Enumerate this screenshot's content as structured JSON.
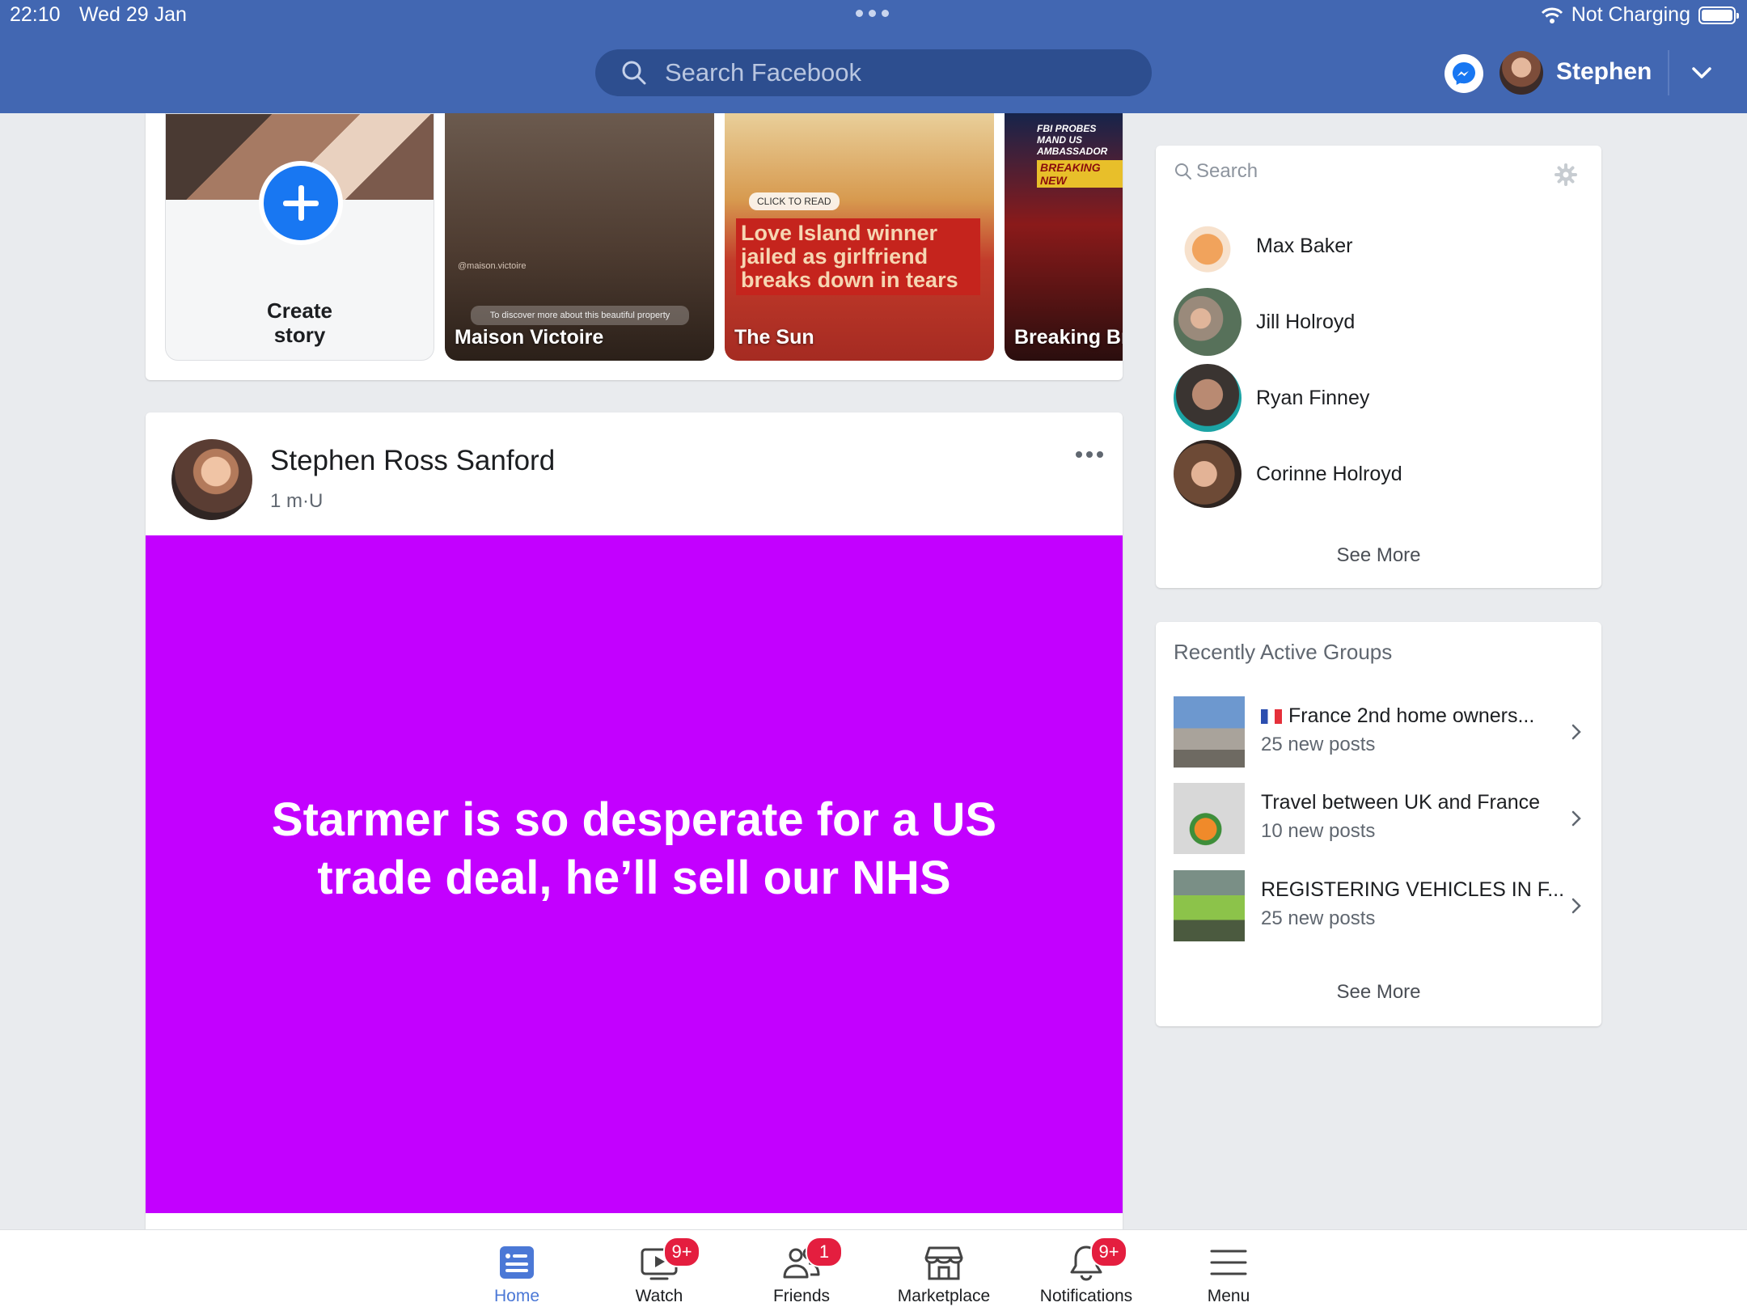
{
  "status_bar": {
    "time": "22:10",
    "date": "Wed 29 Jan",
    "charging": "Not Charging"
  },
  "header": {
    "search_placeholder": "Search Facebook",
    "user_name": "Stephen"
  },
  "stories": {
    "create_line1": "Create",
    "create_line2": "story",
    "items": [
      {
        "name": "Maison Victoire",
        "sub": "@maison.victoire",
        "pill": "To discover more about this beautiful property"
      },
      {
        "name": "The Sun",
        "pill": "CLICK TO READ",
        "headline": "Love Island winner jailed as girlfriend breaks down in tears"
      },
      {
        "name": "Breaking Br",
        "top": "FBI PROBES MAND US AMBASSADOR",
        "tag": "BREAKING NEW"
      }
    ]
  },
  "post": {
    "author": "Stephen Ross Sanford",
    "meta": "1 m·U",
    "text": "Starmer is so desperate for a US trade deal, he’ll sell our NHS",
    "background_color": "#c300ff"
  },
  "contacts": {
    "search_placeholder": "Search",
    "items": [
      {
        "name": "Max Baker"
      },
      {
        "name": "Jill Holroyd"
      },
      {
        "name": "Ryan Finney"
      },
      {
        "name": "Corinne Holroyd"
      }
    ],
    "see_more": "See More"
  },
  "groups": {
    "title": "Recently Active Groups",
    "items": [
      {
        "name": "France 2nd home owners...",
        "posts": "25 new posts",
        "flag": true
      },
      {
        "name": "Travel between UK and France",
        "posts": "10 new posts"
      },
      {
        "name": "REGISTERING VEHICLES IN F...",
        "posts": "25 new posts"
      }
    ],
    "see_more": "See More"
  },
  "tabbar": {
    "items": [
      {
        "label": "Home",
        "active": true
      },
      {
        "label": "Watch",
        "badge": "9+"
      },
      {
        "label": "Friends",
        "badge": "1"
      },
      {
        "label": "Marketplace"
      },
      {
        "label": "Notifications",
        "badge": "9+"
      },
      {
        "label": "Menu"
      }
    ]
  },
  "colors": {
    "header_blue": "#4267b2",
    "search_bg": "#2d4e8f",
    "accent": "#1877f2",
    "badge_red": "#e41e3f",
    "post_bg": "#c300ff"
  }
}
